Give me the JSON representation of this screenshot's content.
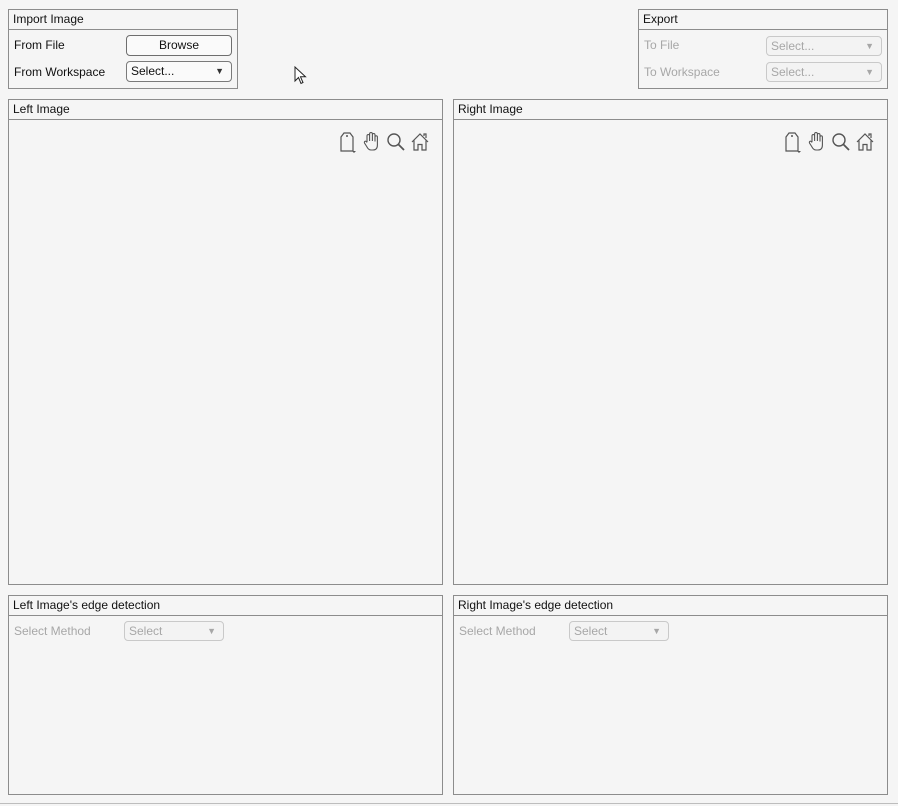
{
  "import": {
    "title": "Import Image",
    "from_file_label": "From File",
    "browse_label": "Browse",
    "from_workspace_label": "From Workspace",
    "workspace_select": "Select..."
  },
  "export": {
    "title": "Export",
    "to_file_label": "To File",
    "to_file_select": "Select...",
    "to_workspace_label": "To Workspace",
    "to_workspace_select": "Select..."
  },
  "left_image": {
    "title": "Left Image"
  },
  "right_image": {
    "title": "Right Image"
  },
  "left_edge": {
    "title": "Left Image's edge detection",
    "method_label": "Select Method",
    "method_select": "Select"
  },
  "right_edge": {
    "title": "Right Image's edge detection",
    "method_label": "Select Method",
    "method_select": "Select"
  },
  "axes_toolbar_icons": [
    "data-tip-icon",
    "pan-hand-icon",
    "zoom-icon",
    "home-icon"
  ]
}
